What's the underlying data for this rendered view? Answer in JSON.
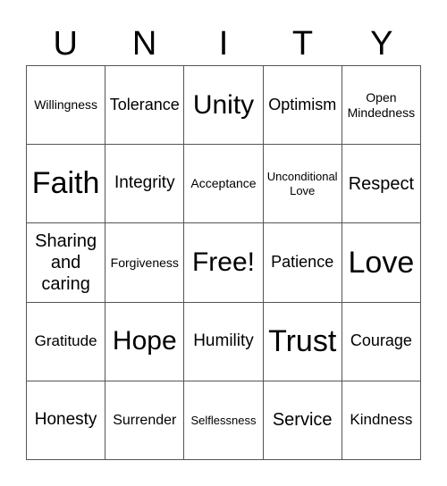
{
  "header": {
    "letters": [
      "U",
      "N",
      "I",
      "T",
      "Y"
    ]
  },
  "grid": {
    "rows": [
      [
        "Willingness",
        "Tolerance",
        "Unity",
        "Optimism",
        "Open Mindedness"
      ],
      [
        "Faith",
        "Integrity",
        "Acceptance",
        "Unconditional Love",
        "Respect"
      ],
      [
        "Sharing and caring",
        "Forgiveness",
        "Free!",
        "Patience",
        "Love"
      ],
      [
        "Gratitude",
        "Hope",
        "Humility",
        "Trust",
        "Courage"
      ],
      [
        "Honesty",
        "Surrender",
        "Selflessness",
        "Service",
        "Kindness"
      ]
    ]
  }
}
